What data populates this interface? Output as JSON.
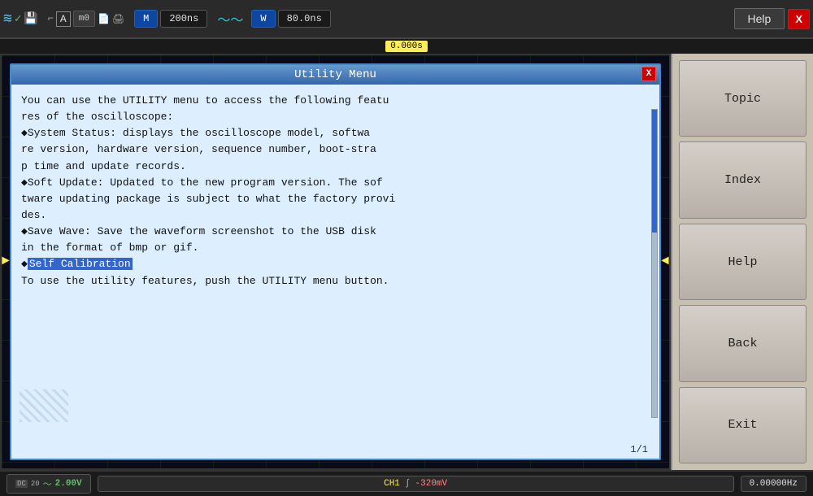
{
  "toolbar": {
    "time_main": "200ns",
    "time_window": "80.0ns",
    "mode_label": "M",
    "window_label": "W",
    "time_offset": "0.000s",
    "help_label": "Help",
    "close_label": "X",
    "m0_label": "m0"
  },
  "dialog": {
    "title": "Utility Menu",
    "close_label": "X",
    "content_lines": [
      "You can use the UTILITY menu to access the following featu",
      "res of the oscilloscope:",
      "◆System Status: displays the oscilloscope model, softwa",
      "re version, hardware version, sequence number, boot-stra",
      "p time and update records.",
      "◆Soft Update: Updated to the new program version. The sof",
      "tware updating package is subject to what the factory provi",
      "des.",
      "◆Save Wave: Save the waveform screenshot to the USB disk",
      "in the format of bmp or gif.",
      "◆",
      "To use the utility features, push the UTILITY menu button."
    ],
    "highlighted_text": "Self Calibration",
    "page_indicator": "1/1"
  },
  "help_panel": {
    "buttons": [
      {
        "label": "Topic",
        "id": "topic"
      },
      {
        "label": "Index",
        "id": "index"
      },
      {
        "label": "Help",
        "id": "help"
      },
      {
        "label": "Back",
        "id": "back"
      },
      {
        "label": "Exit",
        "id": "exit"
      }
    ]
  },
  "status_bar": {
    "dc_label": "DC",
    "coupling": "20",
    "voltage": "2.00V",
    "ch1_label": "CH1",
    "slash": "∫",
    "mv_value": "-320mV",
    "frequency": "0.00000Hz"
  }
}
